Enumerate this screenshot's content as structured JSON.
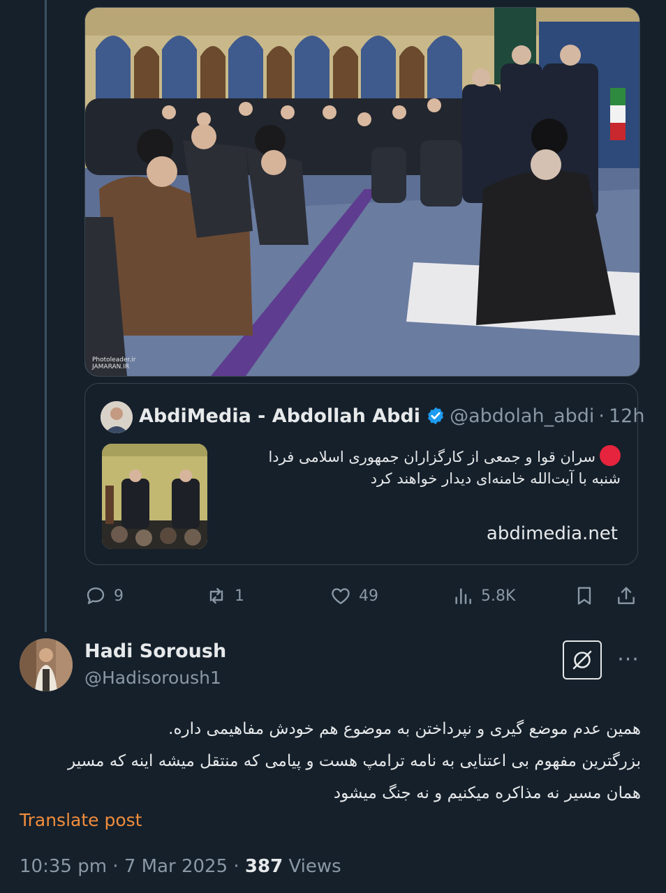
{
  "quoted_tweet": {
    "author_name": "AbdiMedia - Abdollah Abdi",
    "handle": "@abdolah_abdi",
    "separator": "·",
    "time": "12h",
    "text_line1": "سران قوا و جمعی از کارگزاران جمهوری اسلامی فردا",
    "text_line2": "شنبه با آیت‌الله خامنه‌ای دیدار خواهند کرد",
    "link": "abdimedia.net"
  },
  "media": {
    "watermark_line1": "Photoleader.ir",
    "watermark_line2": "JAMARAN.IR"
  },
  "actions": {
    "replies": "9",
    "reposts": "1",
    "likes": "49",
    "views": "5.8K"
  },
  "reply_tweet": {
    "author_name": "Hadi Soroush",
    "handle": "@Hadisoroush1",
    "more_label": "···",
    "text_lines": [
      "همین عدم موضع گیری و نپرداختن به موضوع هم خودش مفاهیمی داره.",
      "بزرگترین مفهوم بی اعتنایی به نامه ترامپ هست و پیامی که منتقل میشه اینه که مسیر",
      "همان مسیر نه مذاکره میکنیم و نه جنگ میشود"
    ],
    "translate_label": "Translate post",
    "timestamp": "10:35 pm",
    "date": "7 Mar 2025",
    "dot": "·",
    "view_count": "387",
    "views_label": "Views"
  },
  "colors": {
    "background": "#15202b",
    "border": "#38444d",
    "muted_text": "#8b98a5",
    "translate_orange": "#f18d3c",
    "verified_blue": "#1d9bf0",
    "live_red": "#e6243d"
  },
  "icons": {
    "reply": "comment-icon",
    "repost": "repost-icon",
    "like": "heart-icon",
    "views": "analytics-icon",
    "bookmark": "bookmark-icon",
    "share": "share-icon",
    "grok": "grok-icon",
    "verified": "verified-badge-icon"
  }
}
